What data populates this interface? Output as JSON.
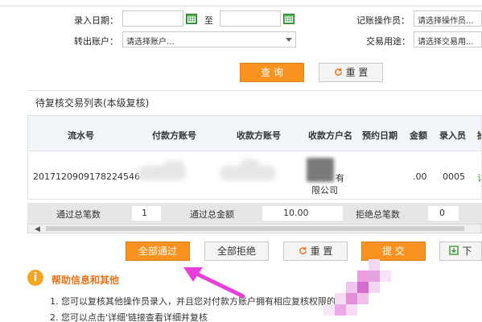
{
  "search": {
    "entry_date_label": "录入日期：",
    "to_label": "至",
    "from_account_label": "转出账户：",
    "from_account_value": "请选择账户...",
    "operator_label": "记账操作员：",
    "operator_value": "请选择操作员...",
    "usage_label": "交易用途：",
    "usage_value": "请选择交易用...",
    "query_button": "查 询",
    "reset_button": "重 置"
  },
  "list": {
    "title": "待复核交易列表(本级复核)",
    "columns": [
      "流水号",
      "付款方账号",
      "收款方账号",
      "收款方户名",
      "预约日期",
      "金额",
      "录入员",
      "操"
    ],
    "rows": [
      {
        "serial": "2017120909178224546",
        "payer_account": "",
        "payee_account": "",
        "payee_name_partial": "有",
        "payee_name_line2": "限公司",
        "amount": ".00",
        "operator": "0005",
        "action_partial": "详"
      }
    ]
  },
  "summary": {
    "passed_count_label": "通过总笔数",
    "passed_count": "1",
    "passed_amount_label": "通过总金额",
    "passed_amount": "10.00",
    "rejected_count_label": "拒绝总笔数",
    "rejected_count": "0"
  },
  "actions": {
    "approve_all": "全部通过",
    "reject_all": "全部拒绝",
    "reset": "重 置",
    "submit": "提 交",
    "download": "下"
  },
  "help": {
    "icon": "info-icon",
    "title": "帮助信息和其他",
    "lines": [
      "1. 您可以复核其他操作员录入，并且您对付款方账户拥有相应复核权限的交",
      "2. 您可以点击'详细'链接查看详细并复核"
    ]
  },
  "colors": {
    "accent_orange": "#f7931e",
    "annotation_arrow": "#e83fd8",
    "table_header_bg": "#f2f5f9",
    "help_title": "#e8731a"
  }
}
